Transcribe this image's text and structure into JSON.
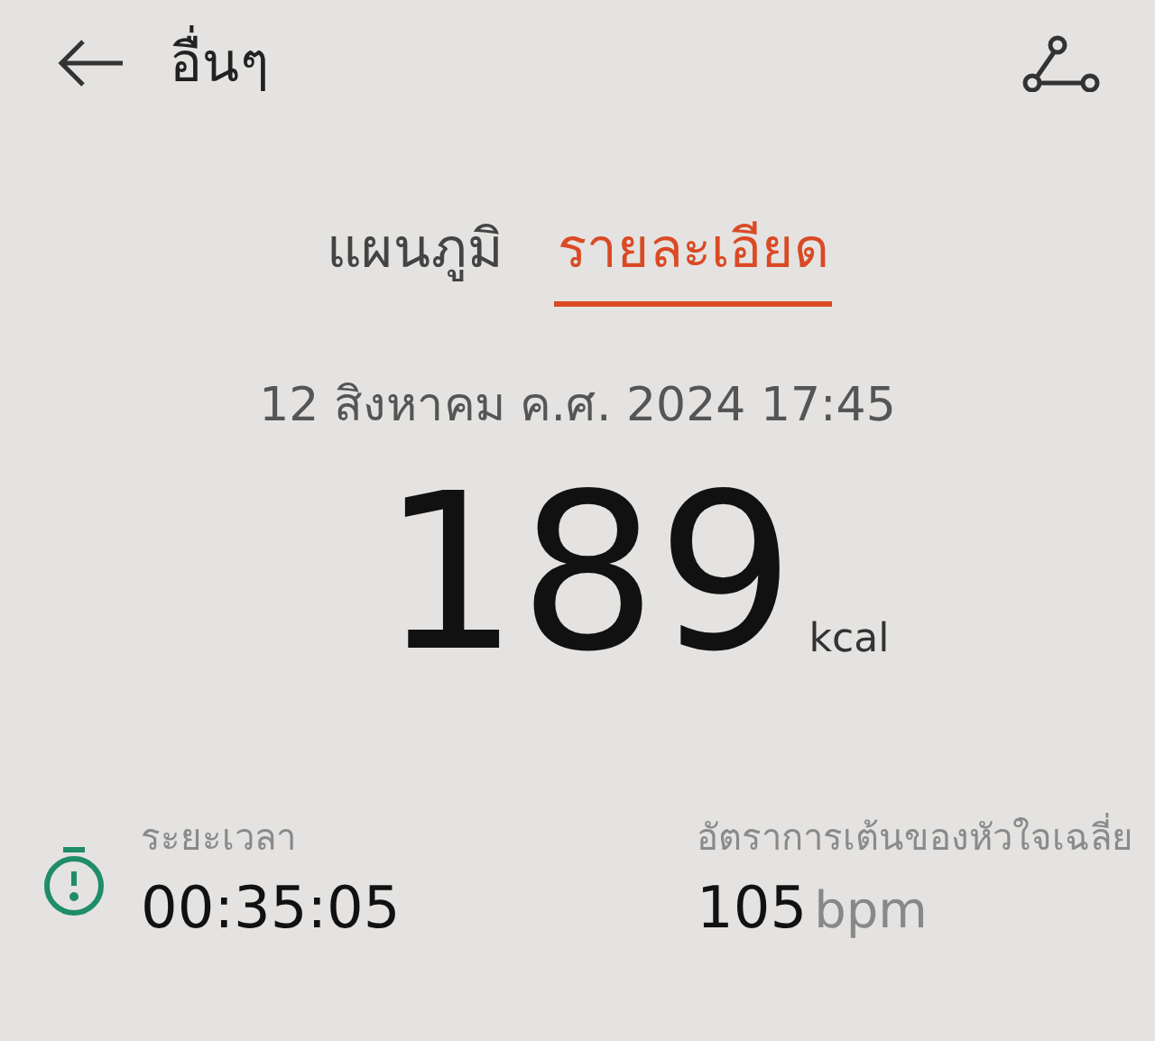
{
  "header": {
    "title": "อื่นๆ"
  },
  "tabs": [
    {
      "label": "แผนภูมิ",
      "selected": false
    },
    {
      "label": "รายละเอียด",
      "selected": true
    }
  ],
  "date": "12 สิงหาคม ค.ศ. 2024 17:45",
  "calories": {
    "value": "189",
    "unit": "kcal"
  },
  "stats": [
    {
      "kind": "duration",
      "label": "ระยะเวลา",
      "value": "00:35:05"
    },
    {
      "kind": "heart_rate",
      "label": "อัตราการเต้นของหัวใจเฉลี่ย",
      "value": "105",
      "unit": "bpm"
    }
  ]
}
